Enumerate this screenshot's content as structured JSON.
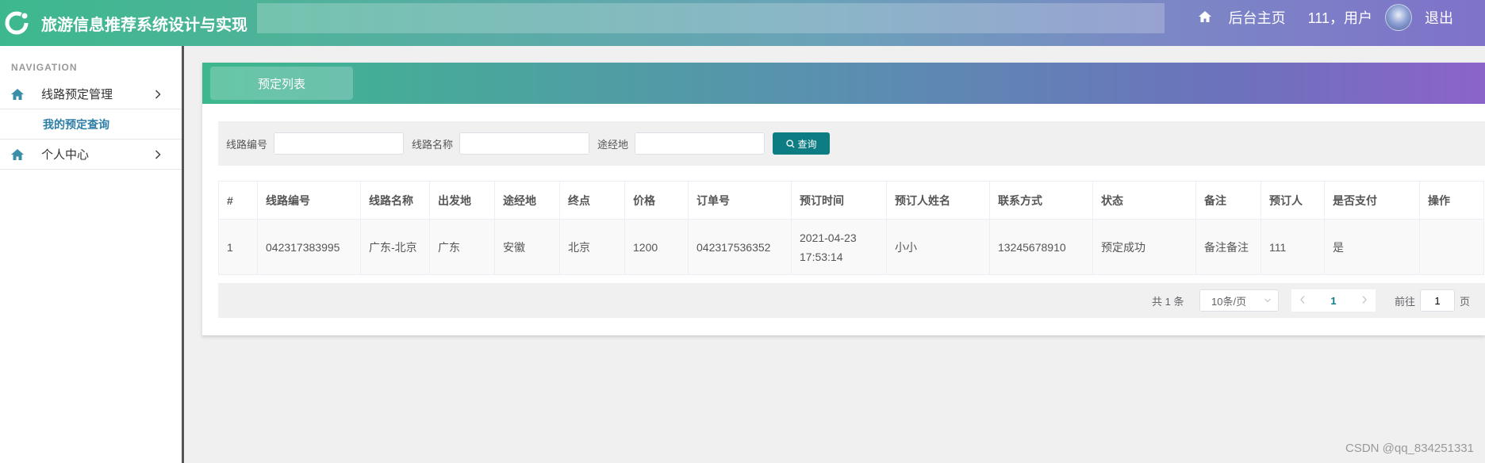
{
  "header": {
    "app_title": "旅游信息推荐系统设计与实现",
    "home_link": "后台主页",
    "user_text": "111，用户",
    "logout": "退出",
    "icons": [
      "refresh-logo-icon",
      "home-icon",
      "avatar"
    ]
  },
  "sidebar": {
    "caption": "NAVIGATION",
    "items": [
      {
        "label": "线路预定管理",
        "icon": "home-icon",
        "expanded": true,
        "children": [
          {
            "label": "我的预定查询"
          }
        ]
      },
      {
        "label": "个人中心",
        "icon": "home-icon",
        "expanded": false
      }
    ]
  },
  "main": {
    "tab_label": "预定列表",
    "search": {
      "route_no_label": "线路编号",
      "route_name_label": "线路名称",
      "via_label": "途经地",
      "button_label": "查询"
    },
    "table": {
      "columns": [
        "#",
        "线路编号",
        "线路名称",
        "出发地",
        "途经地",
        "终点",
        "价格",
        "订单号",
        "预订时间",
        "预订人姓名",
        "联系方式",
        "状态",
        "备注",
        "预订人",
        "是否支付",
        "操作"
      ],
      "rows": [
        [
          "1",
          "042317383995",
          "广东-北京",
          "广东",
          "安徽",
          "北京",
          "1200",
          "042317536352",
          "2021-04-23 17:53:14",
          "小小",
          "13245678910",
          "预定成功",
          "备注备注",
          "111",
          "是",
          ""
        ]
      ]
    },
    "pagination": {
      "total": "共 1 条",
      "page_size": "10条/页",
      "current_page": "1",
      "goto_label": "前往",
      "goto_value": "1",
      "page_suffix": "页"
    }
  },
  "watermark": "CSDN @qq_834251331",
  "colors": {
    "accent_green": "#3db88e",
    "accent_purple": "#8c63c9",
    "button_teal": "#0e7c83",
    "sub_link": "#2d7ea7"
  }
}
